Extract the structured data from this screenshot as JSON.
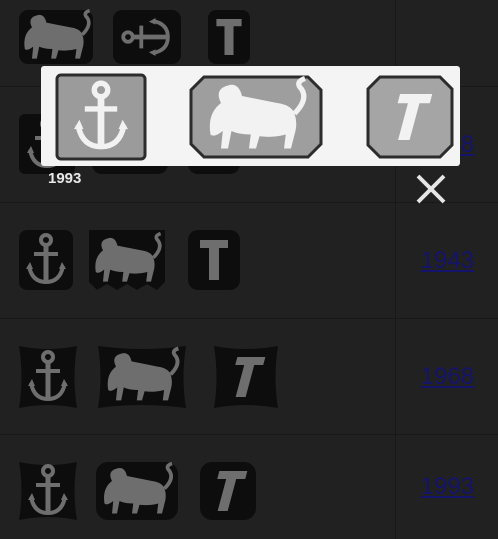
{
  "rows": [
    {
      "year": ""
    },
    {
      "year": "1918"
    },
    {
      "year": "1943"
    },
    {
      "year": "1968"
    },
    {
      "year": "1993"
    }
  ],
  "lightbox": {
    "caption": "1993",
    "close_icon": "close-icon"
  },
  "colors": {
    "page_bg": "#2b2b2b",
    "link": "#1a1a8c",
    "popup_bg": "#f4f4f4",
    "mark_silver": "#9a9a9a"
  }
}
